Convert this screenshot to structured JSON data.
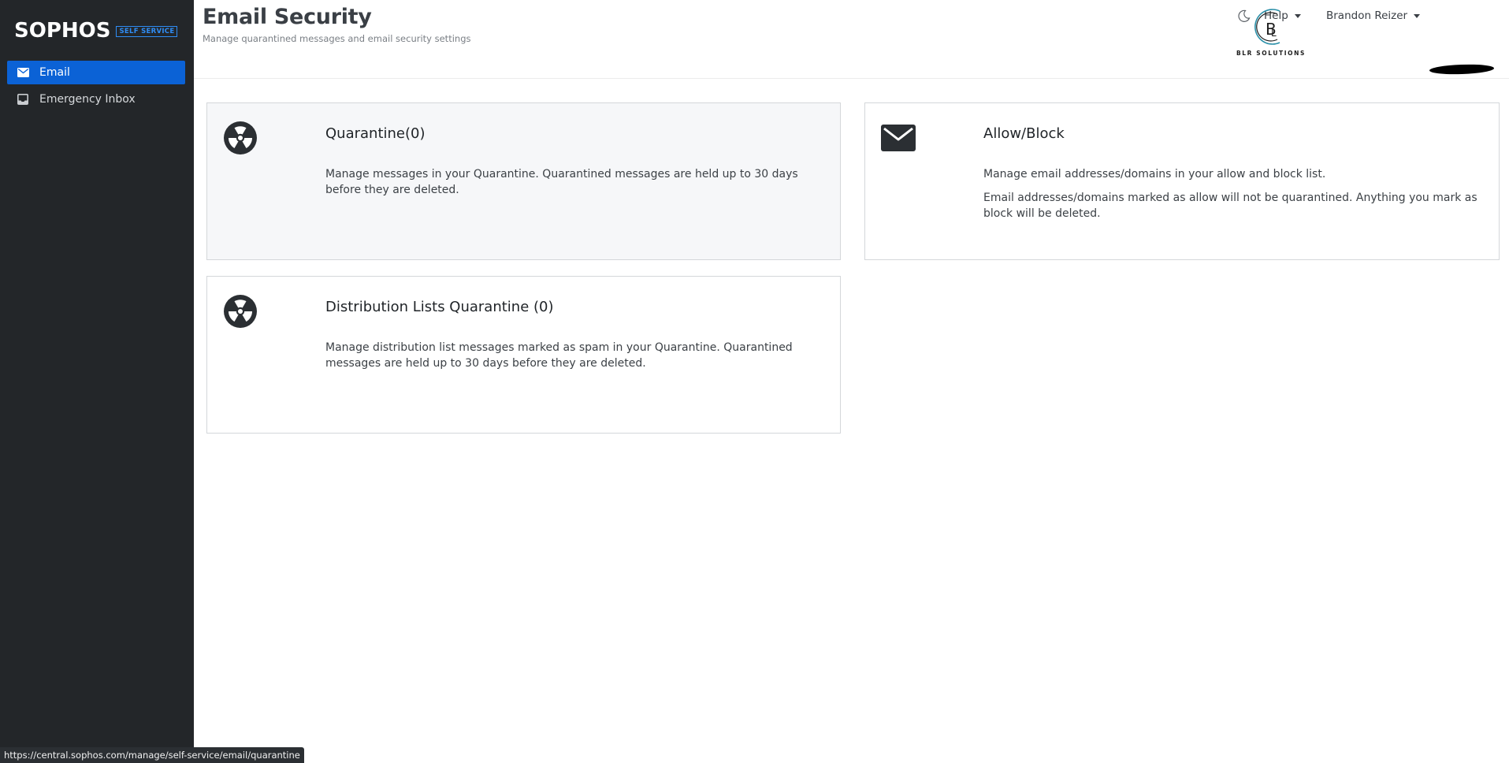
{
  "brand": {
    "name": "SOPHOS",
    "badge": "SELF SERVICE"
  },
  "sidebar": {
    "items": [
      {
        "label": "Email",
        "icon": "mail-icon",
        "active": true
      },
      {
        "label": "Emergency Inbox",
        "icon": "inbox-icon",
        "active": false
      }
    ]
  },
  "header": {
    "title": "Email Security",
    "subtitle": "Manage quarantined messages and email security settings",
    "help_label": "Help",
    "user_label": "Brandon Reizer",
    "logo_text": "BLR SOLUTIONS"
  },
  "cards": {
    "quarantine": {
      "title": "Quarantine(0)",
      "icon": "radiation-icon",
      "description": "Manage messages in your Quarantine. Quarantined messages are held up to 30 days before they are deleted."
    },
    "allowblock": {
      "title": "Allow/Block",
      "icon": "envelope-icon",
      "description_1": "Manage email addresses/domains in your allow and block list.",
      "description_2": "Email addresses/domains marked as allow will not be quarantined. Anything you mark as block will be deleted."
    },
    "distribution": {
      "title": "Distribution Lists Quarantine (0)",
      "icon": "radiation-icon",
      "description": "Manage distribution list messages marked as spam in your Quarantine. Quarantined messages are held up to 30 days before they are deleted."
    }
  },
  "status_bar": {
    "url": "https://central.sophos.com/manage/self-service/email/quarantine"
  },
  "colors": {
    "sidebar_bg": "#232629",
    "accent": "#0b62d6",
    "badge": "#2f8df5"
  }
}
